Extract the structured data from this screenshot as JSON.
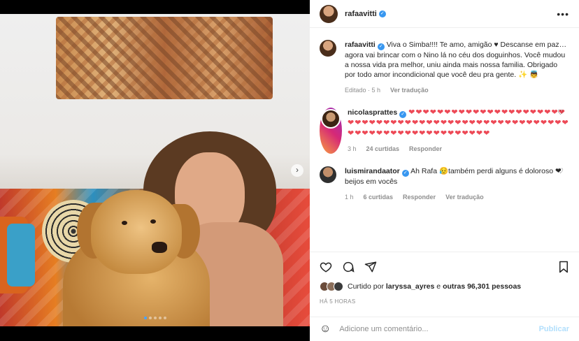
{
  "post": {
    "username": "rafaavitti",
    "more_label": "•••"
  },
  "caption": {
    "username": "rafaavitti",
    "text": "Viva o Simba!!!! Te amo, amigão ♥ Descanse em paz… agora vai brincar com o Nino lá no céu dos doguinhos. Você mudou a nossa vida pra melhor, uniu ainda mais nossa familia. Obrigado por todo amor incondicional que você deu pra gente. ✨ 👼",
    "edited": "Editado · 5 h",
    "see_translation": "Ver tradução"
  },
  "comments": [
    {
      "username": "nicolasprattes",
      "text": "❤❤❤❤❤❤❤❤❤❤❤❤❤❤❤❤❤❤❤❤❤❤❤❤❤❤❤❤❤❤❤❤❤❤❤❤❤❤❤❤❤❤❤❤❤❤❤❤❤❤❤❤❤❤❤❤❤❤❤❤❤❤❤❤❤❤❤❤❤❤❤❤❤",
      "time": "3 h",
      "likes": "24 curtidas",
      "reply": "Responder"
    },
    {
      "username": "luismirandaator",
      "text": "Ah Rafa 😥também perdi alguns é doloroso ❤ beijos em vocês",
      "time": "1 h",
      "likes": "6 curtidas",
      "reply": "Responder",
      "see_translation": "Ver tradução"
    }
  ],
  "likes": {
    "prefix": "Curtido por",
    "user": "laryssa_ayres",
    "middle": "e",
    "others": "outras 96,301 pessoas"
  },
  "timestamp": "HÁ 5 HORAS",
  "comment_box": {
    "placeholder": "Adicione um comentário...",
    "post_label": "Publicar"
  },
  "carousel": {
    "count": 5,
    "active_index": 0
  },
  "icons": {
    "heart": "heart-icon",
    "comment": "comment-icon",
    "share": "share-icon",
    "save": "bookmark-icon",
    "emoji": "emoji-icon",
    "next": "chevron-right-icon"
  },
  "colors": {
    "verified": "#3897f0",
    "heart_red": "#ed4956",
    "post_button_disabled": "#b2dffc",
    "meta_gray": "#8e8e8e"
  }
}
